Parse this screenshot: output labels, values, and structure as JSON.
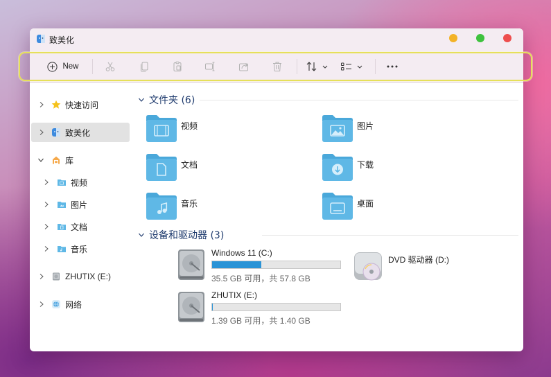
{
  "window": {
    "title": "致美化"
  },
  "toolbar": {
    "new_label": "New",
    "buttons": [
      "cut-icon",
      "copy-icon",
      "paste-icon",
      "rename-icon",
      "share-icon",
      "delete-icon",
      "sort-icon",
      "view-icon",
      "more-icon"
    ]
  },
  "sidebar": {
    "items": [
      {
        "label": "快速访问",
        "icon": "star-icon"
      },
      {
        "label": "致美化",
        "icon": "finder-icon",
        "selected": true
      },
      {
        "label": "库",
        "icon": "library-icon",
        "expanded": true
      },
      {
        "label": "视频",
        "icon": "video-folder-icon"
      },
      {
        "label": "图片",
        "icon": "pictures-folder-icon"
      },
      {
        "label": "文档",
        "icon": "documents-folder-icon"
      },
      {
        "label": "音乐",
        "icon": "music-folder-icon"
      },
      {
        "label": "ZHUTIX (E:)",
        "icon": "drive-icon"
      },
      {
        "label": "网络",
        "icon": "network-icon"
      }
    ]
  },
  "content": {
    "folders_header": "文件夹 (6)",
    "folders": [
      {
        "name": "视频",
        "icon": "video-folder-icon"
      },
      {
        "name": "图片",
        "icon": "pictures-folder-icon"
      },
      {
        "name": "文档",
        "icon": "documents-folder-icon"
      },
      {
        "name": "下载",
        "icon": "downloads-folder-icon"
      },
      {
        "name": "音乐",
        "icon": "music-folder-icon"
      },
      {
        "name": "桌面",
        "icon": "desktop-folder-icon"
      }
    ],
    "drives_header": "设备和驱动器 (3)",
    "drives": [
      {
        "name": "Windows 11 (C:)",
        "info": "35.5 GB 可用，共 57.8 GB",
        "used_fraction": 0.386
      },
      {
        "name": "DVD 驱动器 (D:)",
        "info": ""
      },
      {
        "name": "ZHUTIX (E:)",
        "info": "1.39 GB 可用，共 1.40 GB",
        "used_fraction": 0.007
      }
    ]
  },
  "colors": {
    "accent": "#2a93d6",
    "folder": "#5fb8e6",
    "highlight": "#e6e05a",
    "titlebar": "#f4ecf2"
  }
}
